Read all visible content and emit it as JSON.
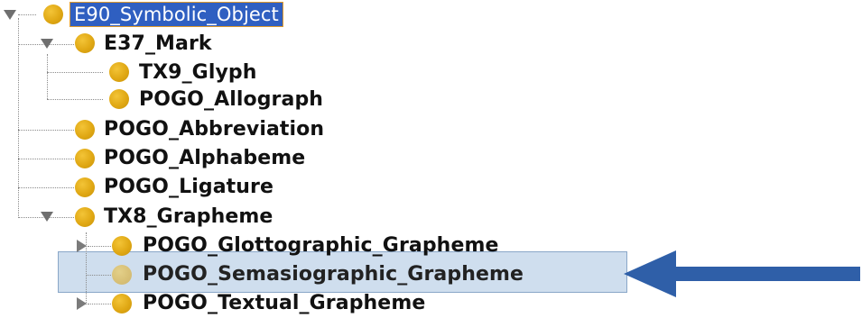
{
  "tree": {
    "root": {
      "label": "E90_Symbolic_Object"
    },
    "items": [
      {
        "label": "E37_Mark"
      },
      {
        "label": "TX9_Glyph"
      },
      {
        "label": "POGO_Allograph"
      },
      {
        "label": "POGO_Abbreviation"
      },
      {
        "label": "POGO_Alphabeme"
      },
      {
        "label": "POGO_Ligature"
      },
      {
        "label": "TX8_Grapheme"
      },
      {
        "label": "POGO_Glottographic_Grapheme"
      },
      {
        "label": "POGO_Semasiographic_Grapheme"
      },
      {
        "label": "POGO_Textual_Grapheme"
      }
    ]
  },
  "colors": {
    "node": "#e0a814",
    "root_selection": "#2f5fc1",
    "row_highlight": "#cfdeee",
    "arrow": "#2f5fa8"
  },
  "icons": [
    "expand-triangle-icon",
    "collapse-triangle-icon",
    "class-node-icon",
    "pointer-arrow-icon"
  ]
}
